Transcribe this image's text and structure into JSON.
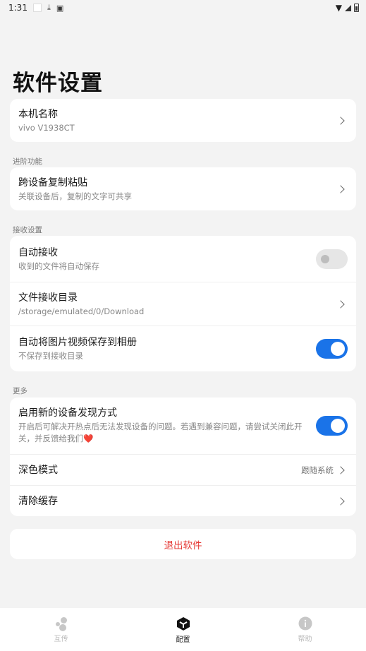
{
  "status_bar": {
    "time": "1:31"
  },
  "title": "软件设置",
  "device": {
    "label": "本机名称",
    "value": "vivo V1938CT"
  },
  "sections": {
    "advanced": "进阶功能",
    "receive": "接收设置",
    "more": "更多"
  },
  "clipboard": {
    "title": "跨设备复制粘贴",
    "subtitle": "关联设备后，复制的文字可共享"
  },
  "auto_receive": {
    "title": "自动接收",
    "subtitle": "收到的文件将自动保存",
    "enabled": false
  },
  "receive_dir": {
    "title": "文件接收目录",
    "subtitle": "/storage/emulated/0/Download"
  },
  "save_to_album": {
    "title": "自动将图片视频保存到相册",
    "subtitle": "不保存到接收目录",
    "enabled": true
  },
  "new_discovery": {
    "title": "启用新的设备发现方式",
    "subtitle": "开启后可解决开热点后无法发现设备的问题。若遇到兼容问题，请尝试关闭此开关，并反馈给我们❤️",
    "enabled": true
  },
  "dark_mode": {
    "title": "深色模式",
    "value": "跟随系统"
  },
  "clear_cache": {
    "title": "清除缓存"
  },
  "logout": "退出软件",
  "nav": [
    {
      "label": "互传",
      "icon": "transfer-dots-icon",
      "active": false
    },
    {
      "label": "配置",
      "icon": "cube-icon",
      "active": true
    },
    {
      "label": "帮助",
      "icon": "info-icon",
      "active": false
    }
  ],
  "colors": {
    "accent": "#1a73e8",
    "danger": "#e53935",
    "background": "#f3f3f3"
  }
}
